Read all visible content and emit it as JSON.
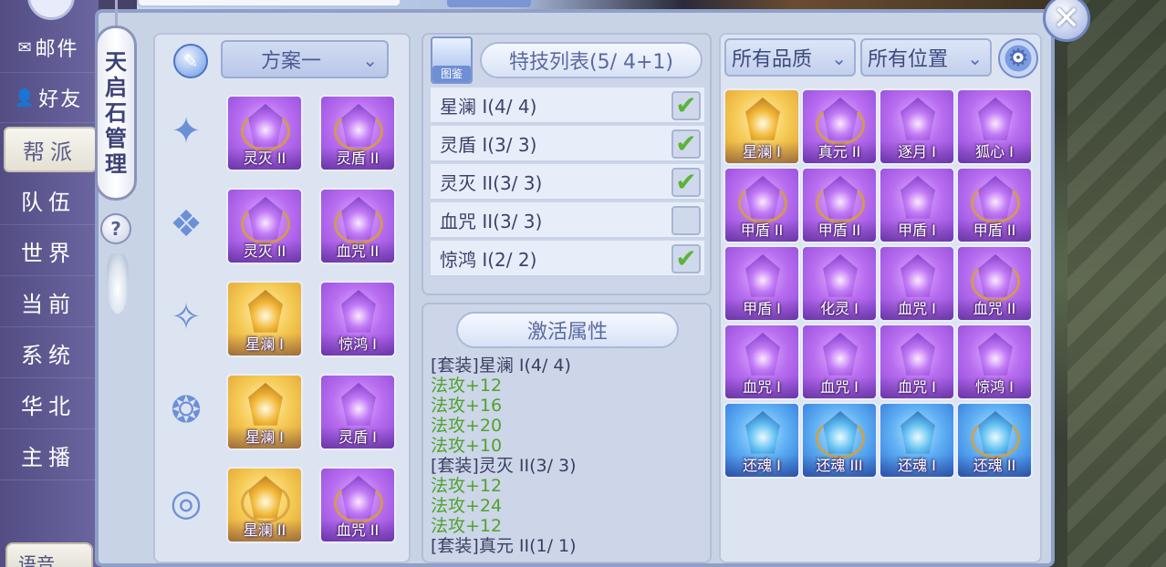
{
  "chat": {
    "channels": [
      {
        "label": "邮件",
        "icon": "mail-icon",
        "glyph": "✉"
      },
      {
        "label": "好友",
        "icon": "user-icon",
        "glyph": "👤"
      },
      {
        "label": "帮派"
      },
      {
        "label": "队伍"
      },
      {
        "label": "世界"
      },
      {
        "label": "当前"
      },
      {
        "label": "系统"
      },
      {
        "label": "华北"
      },
      {
        "label": "主播"
      }
    ],
    "voice_label": "语音"
  },
  "panel": {
    "title_chars": [
      "天",
      "启",
      "石",
      "管",
      "理"
    ],
    "help_glyph": "?",
    "close_glyph": "✕"
  },
  "loadout": {
    "plan_label": "方案一",
    "slots": [
      {
        "slot_icon": "weapon-slot-icon",
        "gems": [
          {
            "label": "灵灭 II",
            "color": "purple"
          },
          {
            "label": "灵盾 II",
            "color": "purple"
          }
        ]
      },
      {
        "slot_icon": "armor-slot-icon",
        "gems": [
          {
            "label": "灵灭 II",
            "color": "purple"
          },
          {
            "label": "血咒 II",
            "color": "purple"
          }
        ]
      },
      {
        "slot_icon": "shoes-slot-icon",
        "gems": [
          {
            "label": "星澜 I",
            "color": "gold"
          },
          {
            "label": "惊鸿 I",
            "color": "purple"
          }
        ]
      },
      {
        "slot_icon": "necklace-slot-icon",
        "gems": [
          {
            "label": "星澜 I",
            "color": "gold"
          },
          {
            "label": "灵盾 I",
            "color": "purple"
          }
        ]
      },
      {
        "slot_icon": "belt-slot-icon",
        "gems": [
          {
            "label": "星澜 II",
            "color": "gold"
          },
          {
            "label": "血咒 II",
            "color": "purple"
          }
        ]
      }
    ]
  },
  "skills": {
    "book_label": "图鉴",
    "title": "特技列表(5/ 4+1)",
    "rows": [
      {
        "label": "星澜 I(4/ 4)",
        "checked": true
      },
      {
        "label": "灵盾 I(3/ 3)",
        "checked": true
      },
      {
        "label": "灵灭 II(3/ 3)",
        "checked": true
      },
      {
        "label": "血咒 II(3/ 3)",
        "checked": false
      },
      {
        "label": "惊鸿 I(2/ 2)",
        "checked": true
      }
    ]
  },
  "attributes": {
    "title": "激活属性",
    "lines": [
      {
        "text": "[套装]星澜 I(4/ 4)",
        "green": false
      },
      {
        "text": "法攻+12",
        "green": true
      },
      {
        "text": "法攻+16",
        "green": true
      },
      {
        "text": "法攻+20",
        "green": true
      },
      {
        "text": "法攻+10",
        "green": true
      },
      {
        "text": "[套装]灵灭 II(3/ 3)",
        "green": false
      },
      {
        "text": "法攻+12",
        "green": true
      },
      {
        "text": "法攻+24",
        "green": true
      },
      {
        "text": "法攻+12",
        "green": true
      },
      {
        "text": "[套装]真元 II(1/ 1)",
        "green": false
      }
    ]
  },
  "inventory": {
    "quality_filter": "所有品质",
    "position_filter": "所有位置",
    "gems": [
      {
        "label": "星澜 I",
        "color": "gold"
      },
      {
        "label": "真元 II",
        "color": "purple"
      },
      {
        "label": "逐月 I",
        "color": "purple"
      },
      {
        "label": "狐心 I",
        "color": "purple"
      },
      {
        "label": "甲盾 II",
        "color": "purple"
      },
      {
        "label": "甲盾 II",
        "color": "purple"
      },
      {
        "label": "甲盾 I",
        "color": "purple"
      },
      {
        "label": "甲盾 II",
        "color": "purple"
      },
      {
        "label": "甲盾 I",
        "color": "purple"
      },
      {
        "label": "化灵 I",
        "color": "purple"
      },
      {
        "label": "血咒 I",
        "color": "purple"
      },
      {
        "label": "血咒 II",
        "color": "purple"
      },
      {
        "label": "血咒 I",
        "color": "purple"
      },
      {
        "label": "血咒 I",
        "color": "purple"
      },
      {
        "label": "血咒 I",
        "color": "purple"
      },
      {
        "label": "惊鸿 I",
        "color": "purple"
      },
      {
        "label": "还魂 I",
        "color": "blue"
      },
      {
        "label": "还魂 III",
        "color": "blue"
      },
      {
        "label": "还魂 I",
        "color": "blue"
      },
      {
        "label": "还魂 II",
        "color": "blue"
      }
    ]
  },
  "colors": {
    "panel_bg": "#c9d3e6",
    "accent_blue": "#4f6cb6",
    "check_green": "#5ab43a",
    "attr_green": "#4ea32e"
  }
}
